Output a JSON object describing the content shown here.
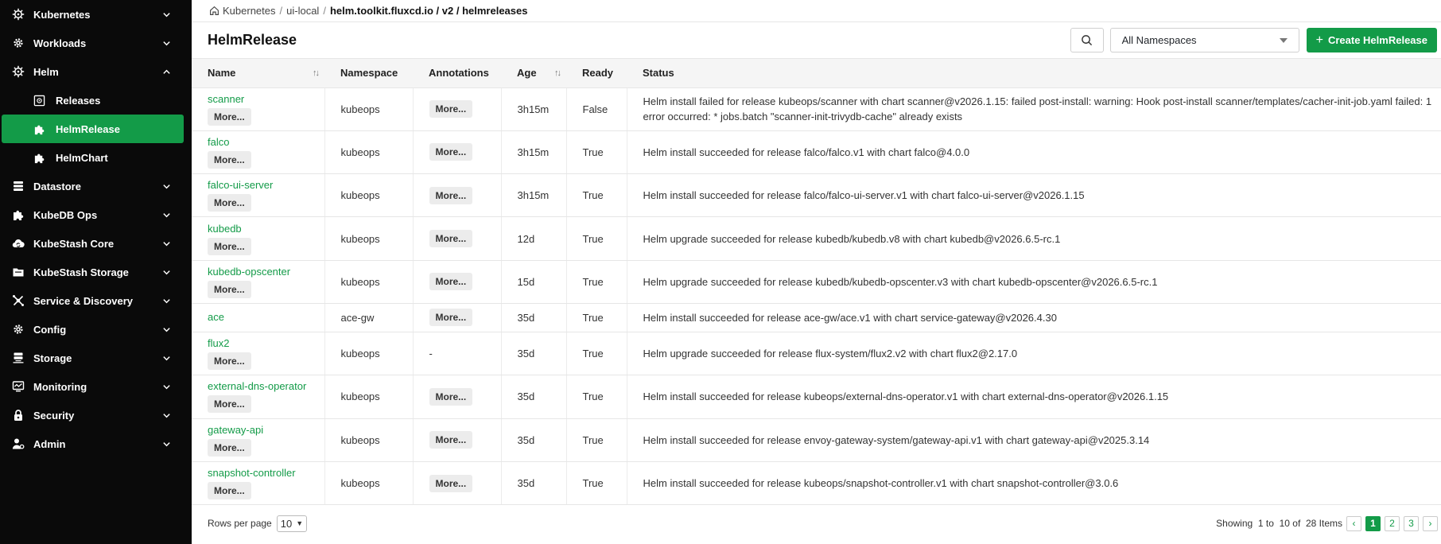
{
  "sidebar": {
    "items": [
      {
        "label": "Kubernetes",
        "icon": "helm-wheel-icon",
        "expanded": false
      },
      {
        "label": "Workloads",
        "icon": "gear-icon",
        "expanded": false
      },
      {
        "label": "Helm",
        "icon": "helm-wheel-icon",
        "expanded": true
      },
      {
        "label": "Datastore",
        "icon": "database-icon",
        "expanded": false
      },
      {
        "label": "KubeDB Ops",
        "icon": "puzzle-icon",
        "expanded": false
      },
      {
        "label": "KubeStash Core",
        "icon": "cloud-sync-icon",
        "expanded": false
      },
      {
        "label": "KubeStash Storage",
        "icon": "folder-icon",
        "expanded": false
      },
      {
        "label": "Service & Discovery",
        "icon": "network-icon",
        "expanded": false
      },
      {
        "label": "Config",
        "icon": "gear-icon",
        "expanded": false
      },
      {
        "label": "Storage",
        "icon": "storage-icon",
        "expanded": false
      },
      {
        "label": "Monitoring",
        "icon": "monitor-icon",
        "expanded": false
      },
      {
        "label": "Security",
        "icon": "lock-icon",
        "expanded": false
      },
      {
        "label": "Admin",
        "icon": "user-gear-icon",
        "expanded": false
      }
    ],
    "helm_subitems": [
      {
        "label": "Releases",
        "icon": "release-icon",
        "active": false
      },
      {
        "label": "HelmRelease",
        "icon": "puzzle-icon",
        "active": true
      },
      {
        "label": "HelmChart",
        "icon": "puzzle-icon",
        "active": false
      }
    ]
  },
  "breadcrumb": {
    "home": "Kubernetes",
    "cluster": "ui-local",
    "current": "helm.toolkit.fluxcd.io / v2 / helmreleases"
  },
  "header": {
    "title": "HelmRelease",
    "namespace_select": "All Namespaces",
    "create_label": "Create HelmRelease"
  },
  "table": {
    "columns": [
      "Name",
      "Namespace",
      "Annotations",
      "Age",
      "Ready",
      "Status"
    ],
    "more_label": "More...",
    "rows": [
      {
        "name": "scanner",
        "namespace": "kubeops",
        "annotations": "More...",
        "age": "3h15m",
        "ready": "False",
        "status": "Helm install failed for release kubeops/scanner with chart scanner@v2026.1.15: failed post-install: warning: Hook post-install scanner/templates/cacher-init-job.yaml failed: 1 error occurred: * jobs.batch \"scanner-init-trivydb-cache\" already exists",
        "tall": true
      },
      {
        "name": "falco",
        "namespace": "kubeops",
        "annotations": "More...",
        "age": "3h15m",
        "ready": "True",
        "status": "Helm install succeeded for release falco/falco.v1 with chart falco@4.0.0",
        "tall": true
      },
      {
        "name": "falco-ui-server",
        "namespace": "kubeops",
        "annotations": "More...",
        "age": "3h15m",
        "ready": "True",
        "status": "Helm install succeeded for release falco/falco-ui-server.v1 with chart falco-ui-server@v2026.1.15",
        "tall": true
      },
      {
        "name": "kubedb",
        "namespace": "kubeops",
        "annotations": "More...",
        "age": "12d",
        "ready": "True",
        "status": "Helm upgrade succeeded for release kubedb/kubedb.v8 with chart kubedb@v2026.6.5-rc.1",
        "tall": true
      },
      {
        "name": "kubedb-opscenter",
        "namespace": "kubeops",
        "annotations": "More...",
        "age": "15d",
        "ready": "True",
        "status": "Helm upgrade succeeded for release kubedb/kubedb-opscenter.v3 with chart kubedb-opscenter@v2026.6.5-rc.1",
        "tall": true
      },
      {
        "name": "ace",
        "namespace": "ace-gw",
        "annotations": "More...",
        "age": "35d",
        "ready": "True",
        "status": "Helm install succeeded for release ace-gw/ace.v1 with chart service-gateway@v2026.4.30",
        "tall": false
      },
      {
        "name": "flux2",
        "namespace": "kubeops",
        "annotations": "-",
        "age": "35d",
        "ready": "True",
        "status": "Helm upgrade succeeded for release flux-system/flux2.v2 with chart flux2@2.17.0",
        "tall": true
      },
      {
        "name": "external-dns-operator",
        "namespace": "kubeops",
        "annotations": "More...",
        "age": "35d",
        "ready": "True",
        "status": "Helm install succeeded for release kubeops/external-dns-operator.v1 with chart external-dns-operator@v2026.1.15",
        "tall": true
      },
      {
        "name": "gateway-api",
        "namespace": "kubeops",
        "annotations": "More...",
        "age": "35d",
        "ready": "True",
        "status": "Helm install succeeded for release envoy-gateway-system/gateway-api.v1 with chart gateway-api@v2025.3.14",
        "tall": true
      },
      {
        "name": "snapshot-controller",
        "namespace": "kubeops",
        "annotations": "More...",
        "age": "35d",
        "ready": "True",
        "status": "Helm install succeeded for release kubeops/snapshot-controller.v1 with chart snapshot-controller@3.0.6",
        "tall": true
      }
    ]
  },
  "footer": {
    "rows_per_page_label": "Rows per page",
    "rows_per_page": "10",
    "showing_label": "Showing",
    "from": "1",
    "to_label": "to",
    "to": "10",
    "of_label": "of",
    "total": "28",
    "items_label": "Items",
    "pages": [
      "1",
      "2",
      "3"
    ],
    "current_page": "1"
  },
  "colors": {
    "accent": "#139b48",
    "sidebar_bg": "#0a0a0a"
  }
}
